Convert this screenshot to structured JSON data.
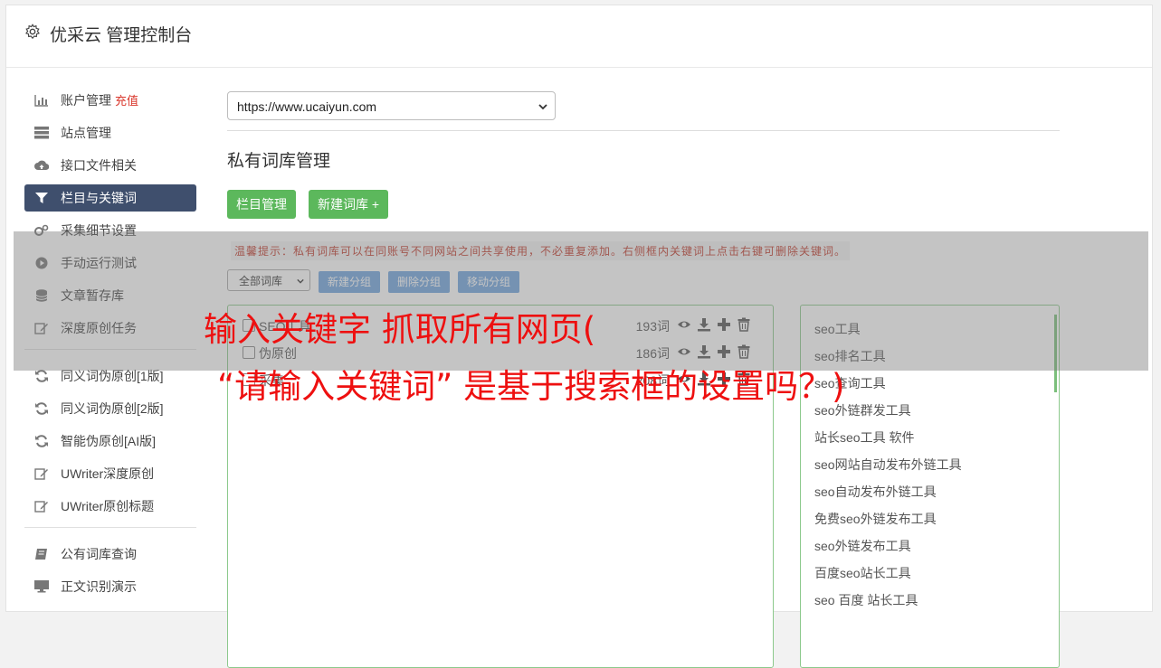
{
  "header": {
    "title": "优采云 管理控制台"
  },
  "sidebar": {
    "items": [
      {
        "label": "账户管理",
        "badge": "充值"
      },
      {
        "label": "站点管理"
      },
      {
        "label": "接口文件相关"
      },
      {
        "label": "栏目与关键词"
      },
      {
        "label": "采集细节设置"
      },
      {
        "label": "手动运行测试"
      },
      {
        "label": "文章暂存库"
      },
      {
        "label": "深度原创任务"
      },
      {
        "label": "同义词伪原创[1版]"
      },
      {
        "label": "同义词伪原创[2版]"
      },
      {
        "label": "智能伪原创[AI版]"
      },
      {
        "label": "UWriter深度原创"
      },
      {
        "label": "UWriter原创标题"
      },
      {
        "label": "公有词库查询"
      },
      {
        "label": "正文识别演示"
      }
    ]
  },
  "main": {
    "site_select": "https://www.ucaiyun.com",
    "section_title": "私有词库管理",
    "btn_columns": "栏目管理",
    "btn_new_lib": "新建词库 +",
    "tip": "温馨提示：私有词库可以在同账号不同网站之间共享使用，不必重复添加。右侧框内关键词上点击右键可删除关键词。",
    "lib_filter": "全部词库",
    "btn_new_group": "新建分组",
    "btn_delete_group": "删除分组",
    "btn_move_group": "移动分组",
    "libraries": [
      {
        "name": "SEO工具",
        "count": "193词"
      },
      {
        "name": "伪原创",
        "count": "186词"
      },
      {
        "name": "采集",
        "count": "208词"
      }
    ],
    "keywords": [
      "seo工具",
      "seo排名工具",
      "seo查询工具",
      "seo外链群发工具",
      "站长seo工具 软件",
      "seo网站自动发布外链工具",
      "seo自动发布外链工具",
      "免费seo外链发布工具",
      "seo外链发布工具",
      "百度seo站长工具",
      "seo 百度 站长工具"
    ]
  },
  "overlay": {
    "line1": "输入关键字 抓取所有网页(",
    "line2": "“请输入关键词” 是基于搜索框的设置吗？)"
  }
}
